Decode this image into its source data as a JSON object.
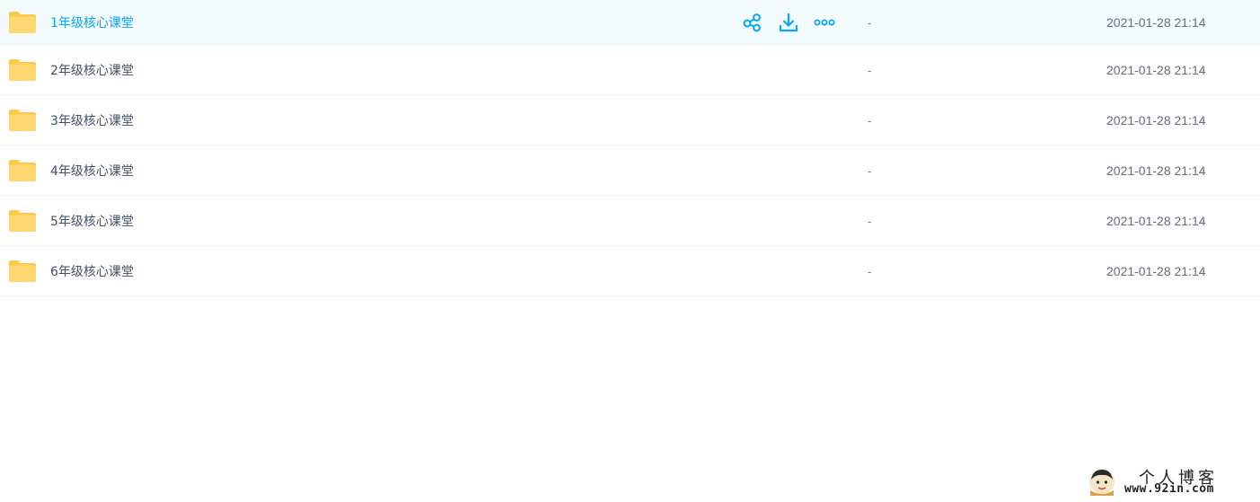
{
  "files": [
    {
      "name": "1年级核心课堂",
      "size": "-",
      "modified": "2021-01-28 21:14"
    },
    {
      "name": "2年级核心课堂",
      "size": "-",
      "modified": "2021-01-28 21:14"
    },
    {
      "name": "3年级核心课堂",
      "size": "-",
      "modified": "2021-01-28 21:14"
    },
    {
      "name": "4年级核心课堂",
      "size": "-",
      "modified": "2021-01-28 21:14"
    },
    {
      "name": "5年级核心课堂",
      "size": "-",
      "modified": "2021-01-28 21:14"
    },
    {
      "name": "6年级核心课堂",
      "size": "-",
      "modified": "2021-01-28 21:14"
    }
  ],
  "row_actions": {
    "share_icon": "share-icon",
    "download_icon": "download-icon",
    "more_icon": "more-icon"
  },
  "watermark": {
    "title": "个人博客",
    "url": "www.92in.com"
  },
  "colors": {
    "accent": "#06a7ff",
    "folder": "#ffd46e",
    "hover_row_bg": "#f4fbff"
  }
}
